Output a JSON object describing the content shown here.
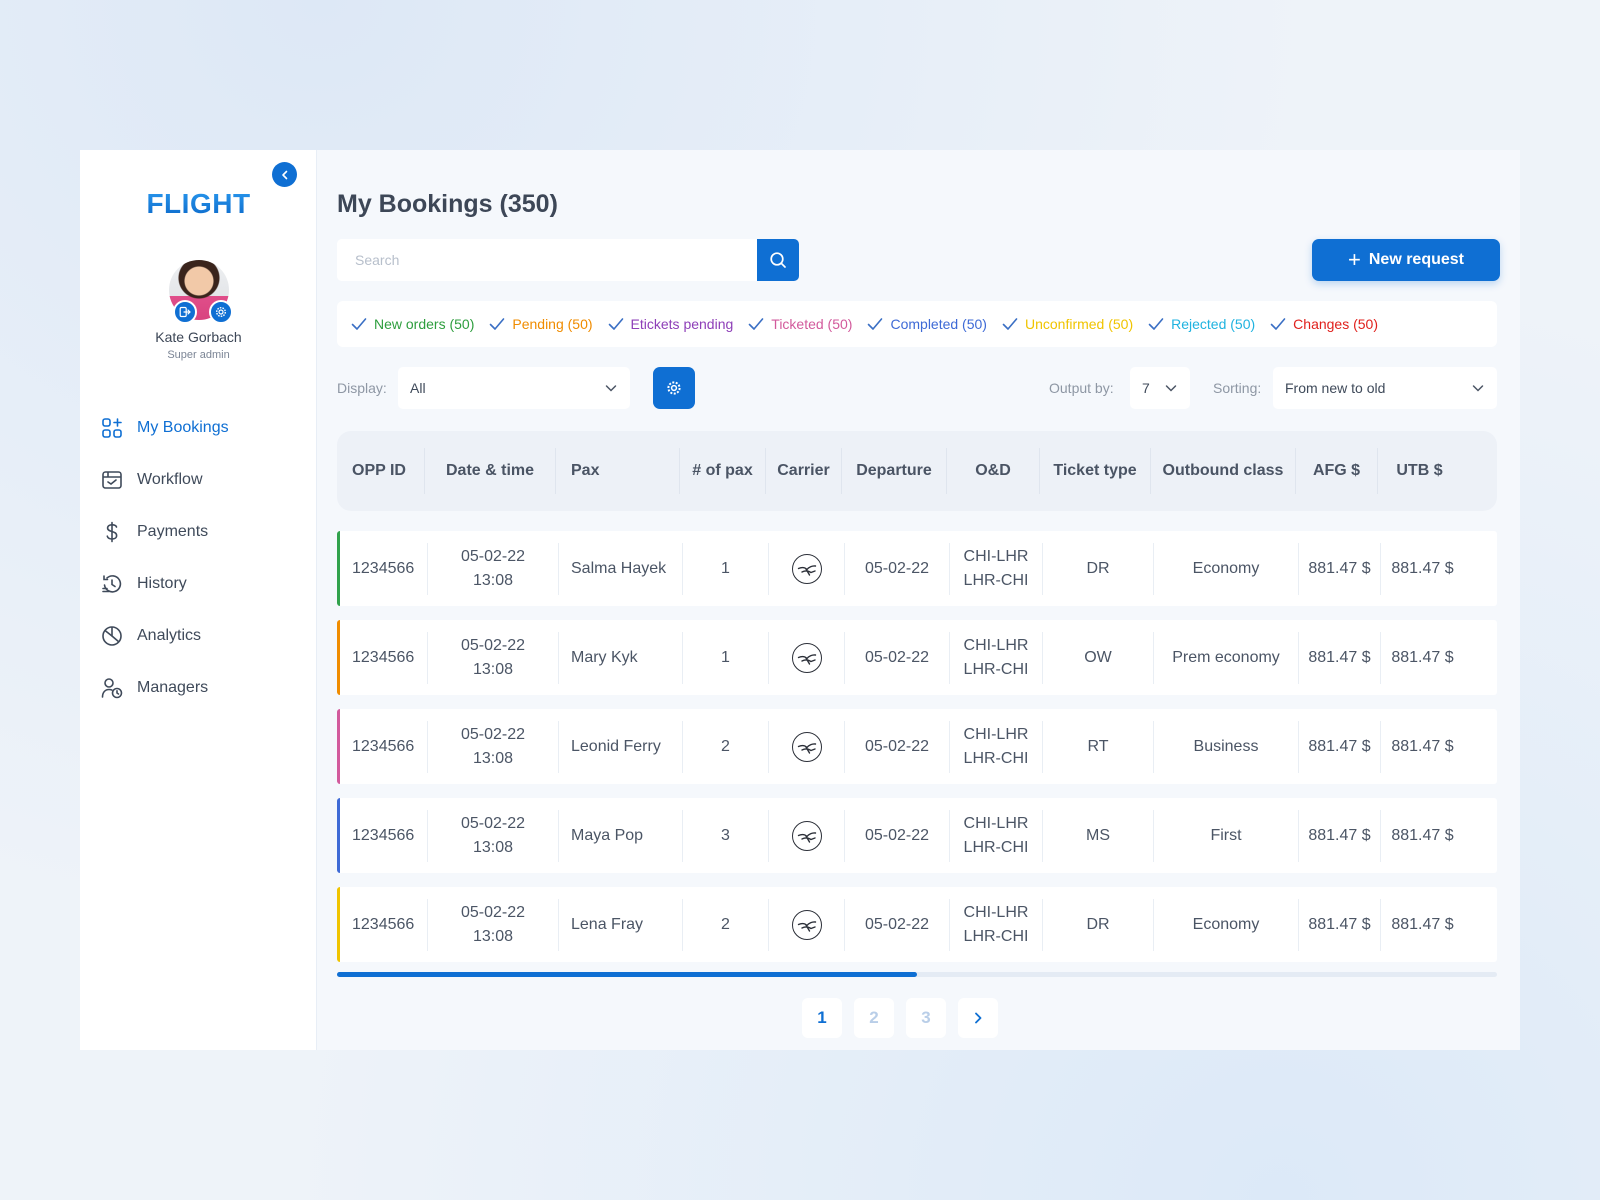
{
  "sidebar": {
    "logo": "FLIGHT",
    "user": {
      "name": "Kate Gorbach",
      "role": "Super admin"
    },
    "nav": [
      {
        "label": "My Bookings",
        "icon": "grid-plus-icon",
        "active": true
      },
      {
        "label": "Workflow",
        "icon": "browser-window-icon",
        "active": false
      },
      {
        "label": "Payments",
        "icon": "dollar-icon",
        "active": false
      },
      {
        "label": "History",
        "icon": "history-icon",
        "active": false
      },
      {
        "label": "Analytics",
        "icon": "pie-chart-icon",
        "active": false
      },
      {
        "label": "Managers",
        "icon": "user-clock-icon",
        "active": false
      }
    ]
  },
  "header": {
    "title": "My Bookings",
    "count": "(350)",
    "search_placeholder": "Search",
    "new_request": "New request"
  },
  "filters": [
    {
      "label": "New orders (50)",
      "color": "#2e9e3e"
    },
    {
      "label": "Pending (50)",
      "color": "#f08c00"
    },
    {
      "label": "Etickets pending",
      "color": "#8e3fb8"
    },
    {
      "label": "Ticketed (50)",
      "color": "#d25a9c"
    },
    {
      "label": "Completed (50)",
      "color": "#3e6ad6"
    },
    {
      "label": "Unconfirmed (50)",
      "color": "#f0c400"
    },
    {
      "label": "Rejected (50)",
      "color": "#1fb3e0"
    },
    {
      "label": "Changes (50)",
      "color": "#e0201c"
    }
  ],
  "controls": {
    "display_label": "Display:",
    "display_value": "All",
    "output_label": "Output by:",
    "output_value": "7",
    "sorting_label": "Sorting:",
    "sorting_value": "From new to old"
  },
  "table": {
    "columns": [
      "OPP ID",
      "Date & time",
      "Pax",
      "# of pax",
      "Carrier",
      "Departure",
      "O&D",
      "Ticket type",
      "Outbound class",
      "AFG $",
      "UTB $"
    ],
    "rows": [
      {
        "status_color": "#31a24c",
        "opp_id": "1234566",
        "date": "05-02-22",
        "time": "13:08",
        "pax": "Salma Hayek",
        "num_pax": "1",
        "carrier": "lufthansa-crane-icon",
        "departure": "05-02-22",
        "od_out": "CHI-LHR",
        "od_in": "LHR-CHI",
        "ticket_type": "DR",
        "outbound_class": "Economy",
        "afg": "881.47 $",
        "utb": "881.47 $"
      },
      {
        "status_color": "#f08c00",
        "opp_id": "1234566",
        "date": "05-02-22",
        "time": "13:08",
        "pax": "Mary Kyk",
        "num_pax": "1",
        "carrier": "lufthansa-crane-icon",
        "departure": "05-02-22",
        "od_out": "CHI-LHR",
        "od_in": "LHR-CHI",
        "ticket_type": "OW",
        "outbound_class": "Prem economy",
        "afg": "881.47 $",
        "utb": "881.47 $"
      },
      {
        "status_color": "#d25a9c",
        "opp_id": "1234566",
        "date": "05-02-22",
        "time": "13:08",
        "pax": "Leonid Ferry",
        "num_pax": "2",
        "carrier": "lufthansa-crane-icon",
        "departure": "05-02-22",
        "od_out": "CHI-LHR",
        "od_in": "LHR-CHI",
        "ticket_type": "RT",
        "outbound_class": "Business",
        "afg": "881.47 $",
        "utb": "881.47 $"
      },
      {
        "status_color": "#3e6ad6",
        "opp_id": "1234566",
        "date": "05-02-22",
        "time": "13:08",
        "pax": "Maya Pop",
        "num_pax": "3",
        "carrier": "lufthansa-crane-icon",
        "departure": "05-02-22",
        "od_out": "CHI-LHR",
        "od_in": "LHR-CHI",
        "ticket_type": "MS",
        "outbound_class": "First",
        "afg": "881.47 $",
        "utb": "881.47 $"
      },
      {
        "status_color": "#f0c400",
        "opp_id": "1234566",
        "date": "05-02-22",
        "time": "13:08",
        "pax": "Lena Fray",
        "num_pax": "2",
        "carrier": "lufthansa-crane-icon",
        "departure": "05-02-22",
        "od_out": "CHI-LHR",
        "od_in": "LHR-CHI",
        "ticket_type": "DR",
        "outbound_class": "Economy",
        "afg": "881.47 $",
        "utb": "881.47 $"
      }
    ],
    "horizontal_scroll_fraction": 0.5
  },
  "pagination": {
    "pages": [
      "1",
      "2",
      "3"
    ],
    "current": "1",
    "next_icon": "chevron-right-icon"
  },
  "colors": {
    "accent": "#0f6fd3"
  }
}
